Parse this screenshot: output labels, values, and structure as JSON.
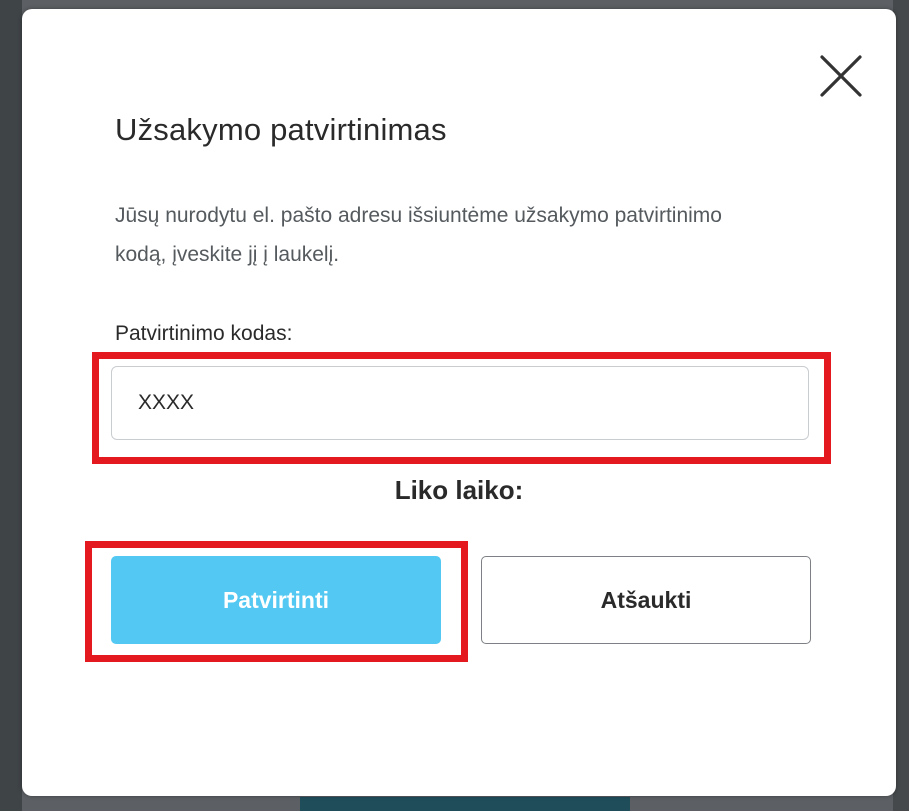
{
  "modal": {
    "title": "Užsakymo patvirtinimas",
    "description": "Jūsų nurodytu el. pašto adresu išsiuntėme užsakymo patvirtinimo kodą, įveskite jį į laukelį.",
    "code_field": {
      "label": "Patvirtinimo kodas:",
      "value": "XXXX"
    },
    "time_label": "Liko laiko:",
    "buttons": {
      "confirm_label": "Patvirtinti",
      "cancel_label": "Atšaukti"
    },
    "close_icon": "close-icon"
  },
  "colors": {
    "confirm_button": "#52c8f2",
    "highlight": "#e3191f",
    "backdrop": "#5c6064"
  }
}
